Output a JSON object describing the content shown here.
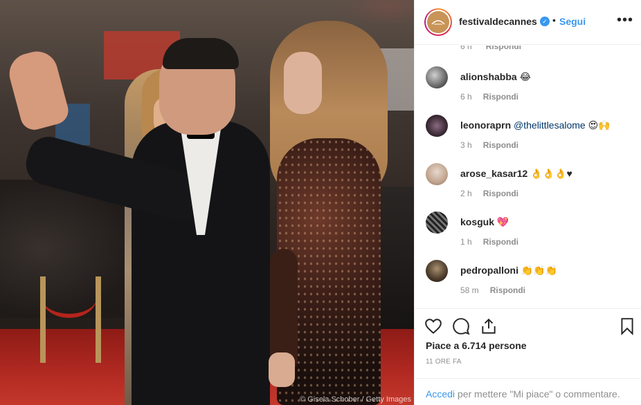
{
  "photo": {
    "credit": "© Gisela Schober / Getty Images"
  },
  "header": {
    "username": "festivaldecannes",
    "follow_label": "Segui",
    "separator": "•",
    "more_label": "•••"
  },
  "partial_comment": {
    "time": "6 h",
    "reply": "Rispondi"
  },
  "comments": [
    {
      "user": "alionshabba",
      "text": "😂",
      "time": "6 h",
      "reply": "Rispondi"
    },
    {
      "user": "leonoraprn",
      "mention": "@thelittlesalome",
      "text": "😍🙌",
      "time": "3 h",
      "reply": "Rispondi"
    },
    {
      "user": "arose_kasar12",
      "text": "👌👌👌♥",
      "time": "2 h",
      "reply": "Rispondi"
    },
    {
      "user": "kosguk",
      "text": "💖",
      "time": "1 h",
      "reply": "Rispondi"
    },
    {
      "user": "pedropalloni",
      "text": "👏👏👏",
      "time": "58 m",
      "reply": "Rispondi"
    }
  ],
  "actions": {
    "likes_text": "Piace a 6.714 persone",
    "timestamp": "11 ORE FA"
  },
  "login_bar": {
    "link": "Accedi",
    "text": " per mettere \"Mi piace\" o commentare."
  },
  "colors": {
    "accent": "#3897f0",
    "muted": "#8e8e8e",
    "text": "#262626"
  }
}
